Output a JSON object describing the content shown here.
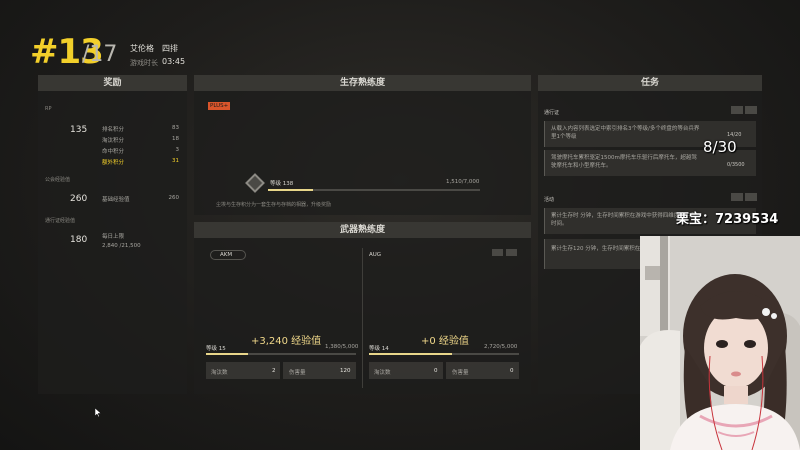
{
  "header": {
    "rank": "#13",
    "total": "/17",
    "player_name": "艾伦格",
    "squad_mode": "四排",
    "time_label": "游戏时长",
    "time_value": "03:45"
  },
  "rewards": {
    "title": "奖励",
    "rp_label": "RP",
    "rp_value": "135",
    "rp_items": [
      {
        "label": "排名积分",
        "value": "83"
      },
      {
        "label": "淘汰积分",
        "value": "18"
      },
      {
        "label": "命中积分",
        "value": "3"
      },
      {
        "label": "额外积分",
        "value": "31"
      }
    ],
    "account_label": "公会经验值",
    "account_value": "260",
    "account_item": {
      "label": "基础经验值",
      "value": "260"
    },
    "pass_label": "通行证经验值",
    "pass_value": "180",
    "pass_item": {
      "label": "每日上限",
      "value": "2,840 /21,500"
    }
  },
  "survival": {
    "title": "生存熟练度",
    "badge": "PLUS+",
    "level_label": "等级 138",
    "level_fraction": 0.21,
    "exp": "1,510/7,000",
    "note": "尘埃与生存积分为一套生存与存档的相器，升级奖励"
  },
  "weapons": {
    "title": "武器熟练度",
    "items": [
      {
        "name": "AKM",
        "exp_gain": "+3,240 经验值",
        "level": "等级 15",
        "fraction": 0.28,
        "exp": "1,380/5,000",
        "kills_label": "淘汰数",
        "kills_value": "2",
        "damage_label": "伤害量",
        "damage_value": "120"
      },
      {
        "name": "AUG",
        "exp_gain": "+0 经验值",
        "level": "等级 14",
        "fraction": 0.55,
        "exp": "2,720/5,000",
        "kills_label": "淘汰数",
        "kills_value": "0",
        "damage_label": "伤害量",
        "damage_value": "0"
      }
    ]
  },
  "tasks": {
    "title": "任务",
    "group1_label": "通行证",
    "group1_items": [
      {
        "text": "从载入内容列表选定中索引排名3个等级/多个终盘的等台兵界里1个等级",
        "progress": "14/20"
      },
      {
        "text": "驾驶摩托车累积驱定1500m摩托车乐驱行后摩托车，超越驾驶摩托车和小型摩托车。",
        "progress": "0/3500"
      }
    ],
    "group2_label": "活动",
    "group2_items": [
      {
        "text": "累计生存时 分钟，生存时间累积在游戏中获得四维度的生存时间。"
      },
      {
        "text": "累计生存120 分钟，生存时间累积在游戏中获得。"
      }
    ]
  },
  "overlay": {
    "progress": "8/30",
    "streamer": "栗宝：7239534"
  }
}
